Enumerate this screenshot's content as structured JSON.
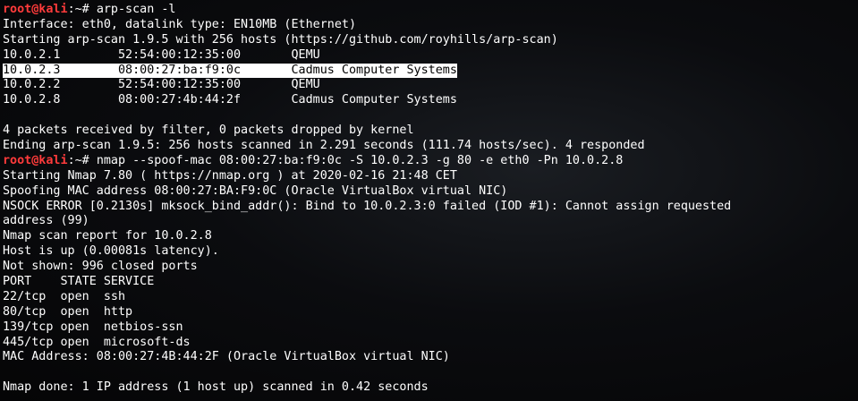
{
  "prompt": {
    "user": "root@kali",
    "suffix": ":~# "
  },
  "commands": {
    "arpscan": "arp-scan -l",
    "nmap": "nmap --spoof-mac 08:00:27:ba:f9:0c -S 10.0.2.3 -g 80 -e eth0 -Pn 10.0.2.8"
  },
  "arpscan_header": [
    "Interface: eth0, datalink type: EN10MB (Ethernet)",
    "Starting arp-scan 1.9.5 with 256 hosts (https://github.com/royhills/arp-scan)"
  ],
  "arp_rows": [
    {
      "ip": "10.0.2.1",
      "mac": "52:54:00:12:35:00",
      "vendor": "QEMU"
    },
    {
      "ip": "10.0.2.3",
      "mac": "08:00:27:ba:f9:0c",
      "vendor": "Cadmus Computer Systems"
    },
    {
      "ip": "10.0.2.2",
      "mac": "52:54:00:12:35:00",
      "vendor": "QEMU"
    },
    {
      "ip": "10.0.2.8",
      "mac": "08:00:27:4b:44:2f",
      "vendor": "Cadmus Computer Systems"
    }
  ],
  "arpscan_footer": [
    "4 packets received by filter, 0 packets dropped by kernel",
    "Ending arp-scan 1.9.5: 256 hosts scanned in 2.291 seconds (111.74 hosts/sec). 4 responded"
  ],
  "nmap_output": [
    "Starting Nmap 7.80 ( https://nmap.org ) at 2020-02-16 21:48 CET",
    "Spoofing MAC address 08:00:27:BA:F9:0C (Oracle VirtualBox virtual NIC)",
    "NSOCK ERROR [0.2130s] mksock_bind_addr(): Bind to 10.0.2.3:0 failed (IOD #1): Cannot assign requested",
    "address (99)",
    "Nmap scan report for 10.0.2.8",
    "Host is up (0.00081s latency).",
    "Not shown: 996 closed ports"
  ],
  "port_table": {
    "header": "PORT    STATE SERVICE",
    "rows": [
      "22/tcp  open  ssh",
      "80/tcp  open  http",
      "139/tcp open  netbios-ssn",
      "445/tcp open  microsoft-ds"
    ]
  },
  "mac_address_line": "MAC Address: 08:00:27:4B:44:2F (Oracle VirtualBox virtual NIC)",
  "nmap_done": "Nmap done: 1 IP address (1 host up) scanned in 0.42 seconds"
}
